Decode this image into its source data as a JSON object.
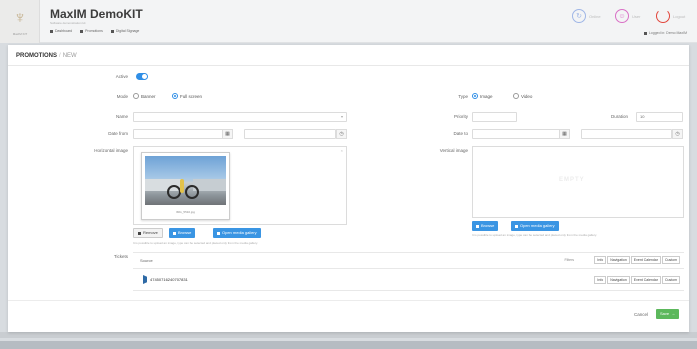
{
  "header": {
    "app_title": "MaxIM DemoKIT",
    "app_subtitle": "Software demonstration kit",
    "logo_subtitle": "MaxIM KIT",
    "nav": [
      {
        "label": "Dashboard",
        "icon": "dashboard-icon"
      },
      {
        "label": "Promotions",
        "icon": "promotions-icon"
      },
      {
        "label": "Digital Signage",
        "icon": "signage-icon"
      }
    ],
    "buttons": [
      {
        "label": "Online",
        "icon": "sync-icon",
        "color": "#9fb6e6"
      },
      {
        "label": "User",
        "icon": "user-icon",
        "color": "#d970c6"
      },
      {
        "label": "Logout",
        "icon": "power-icon",
        "color": "#e2463c"
      }
    ],
    "user_line": "Logged in: Demo MaxIM"
  },
  "breadcrumb": {
    "root": "PROMOTIONS",
    "separator": "/",
    "current": "NEW"
  },
  "form": {
    "active_label": "Active",
    "mode_label": "Mode",
    "mode_options": [
      "Banner",
      "Full screen"
    ],
    "mode_selected": 1,
    "type_label": "Type",
    "type_options": [
      "Image",
      "Video"
    ],
    "type_selected": 0,
    "name_label": "Name",
    "priority_label": "Priority",
    "duration_label": "Duration",
    "duration_value": "10",
    "date_from_label": "Date from",
    "date_to_label": "Date to",
    "horizontal_image_label": "Horizontal image",
    "vertical_image_label": "Vertical image",
    "thumb_caption": "IMG_5510.jpg",
    "h_buttons": {
      "remove": "Remove",
      "browse": "Browse",
      "gallery": "Open media gallery"
    },
    "h_help": "It is possible to upload an image, type can be selected and placed only from the media gallery.",
    "v_buttons": {
      "browse": "Browse",
      "gallery": "Open media gallery"
    },
    "v_help": "It is possible to upload an image, type can be selected and placed only from the media gallery.",
    "v_empty": "EMPTY",
    "tickets_label": "Tickets",
    "tickets_header": "Source",
    "filters_label": "Filters",
    "filter_buttons": [
      "Info",
      "Navigation",
      "Event Calendar",
      "Custom"
    ],
    "ticket_code": "47450716240707831",
    "cancel_label": "Cancel",
    "save_label": "Save"
  },
  "colors": {
    "accent": "#3a95e3",
    "save": "#5cb85c",
    "switch_on": "#2f8ee6"
  }
}
